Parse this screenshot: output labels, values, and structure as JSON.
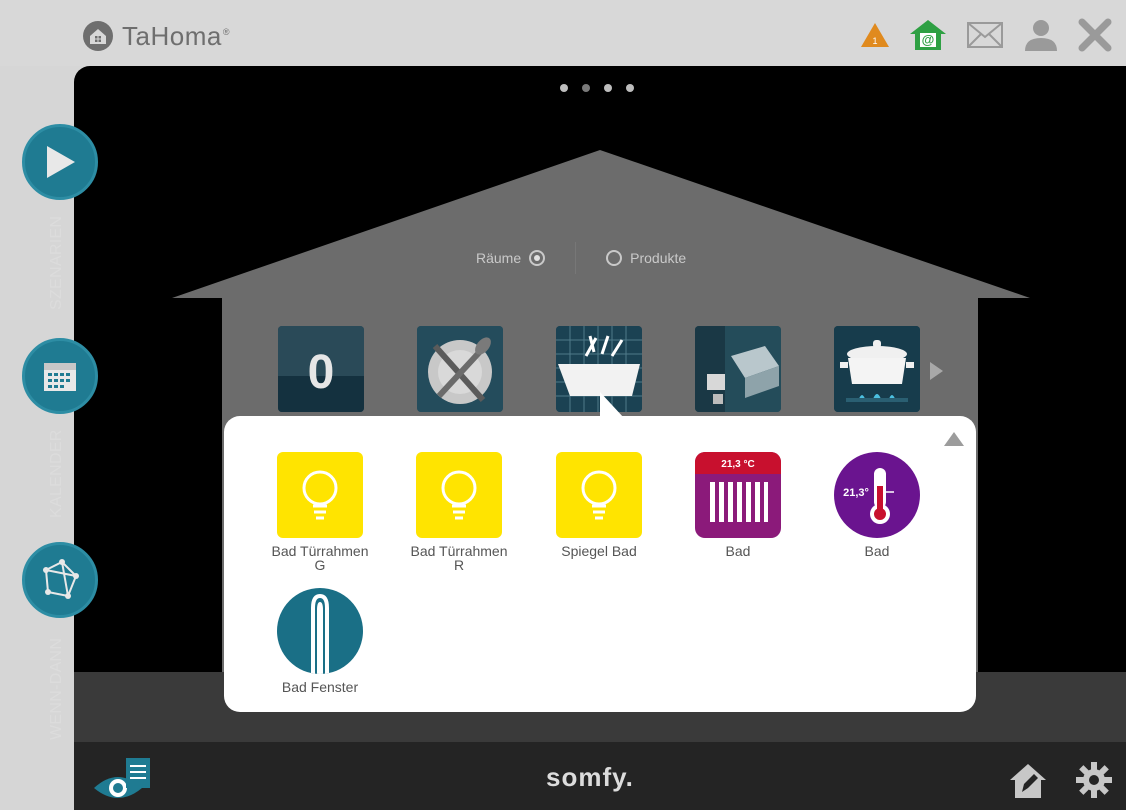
{
  "header": {
    "brand": "TaHoma",
    "brand_mark": "®",
    "alert_count": "1"
  },
  "pager": {
    "pages": 4,
    "active": 0
  },
  "view_toggle": {
    "rooms_label": "Räume",
    "products_label": "Produkte",
    "selected": "rooms"
  },
  "rooms": {
    "items": [
      {
        "name": "room-zero",
        "glyph": "0"
      },
      {
        "name": "room-dining",
        "glyph": ""
      },
      {
        "name": "room-bathroom",
        "glyph": ""
      },
      {
        "name": "room-bedroom",
        "glyph": ""
      },
      {
        "name": "room-kitchen",
        "glyph": ""
      }
    ]
  },
  "products": [
    {
      "label": "Bad Türrahmen G",
      "type": "light"
    },
    {
      "label": "Bad Türrahmen R",
      "type": "light"
    },
    {
      "label": "Spiegel Bad",
      "type": "light"
    },
    {
      "label": "Bad",
      "type": "radiator",
      "reading": "21,3 °C"
    },
    {
      "label": "Bad",
      "type": "thermometer",
      "reading": "21,3°"
    },
    {
      "label": "Bad Fenster",
      "type": "window-sensor"
    }
  ],
  "side_menu": {
    "scenarios": "SZENARIEN",
    "calendar": "KALENDER",
    "rules": "WENN-DANN"
  },
  "footer": {
    "logo": "somfy."
  },
  "colors": {
    "teal": "#1f7b92",
    "light_yellow": "#ffe400",
    "radiator": "#8b1a7a",
    "thermometer": "#6a148f",
    "background": "#000000"
  }
}
